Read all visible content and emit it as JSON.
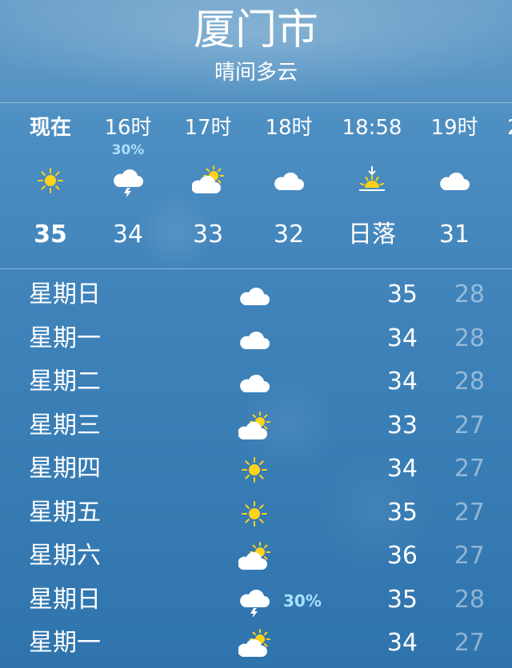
{
  "header": {
    "city": "厦门市",
    "condition": "晴间多云"
  },
  "hourly": [
    {
      "time": "现在",
      "pop": "",
      "icon": "sun-icon",
      "temp": "35"
    },
    {
      "time": "16时",
      "pop": "30%",
      "icon": "thunderstorm-icon",
      "temp": "34"
    },
    {
      "time": "17时",
      "pop": "",
      "icon": "partly-cloudy-icon",
      "temp": "33"
    },
    {
      "time": "18时",
      "pop": "",
      "icon": "cloud-icon",
      "temp": "32"
    },
    {
      "time": "18:58",
      "pop": "",
      "icon": "sunset-icon",
      "temp": "日落"
    },
    {
      "time": "19时",
      "pop": "",
      "icon": "cloud-icon",
      "temp": "31"
    },
    {
      "time": "2",
      "pop": "",
      "icon": "",
      "temp": ""
    }
  ],
  "daily": [
    {
      "day": "星期日",
      "icon": "cloud-icon",
      "pop": "",
      "high": "35",
      "low": "28"
    },
    {
      "day": "星期一",
      "icon": "cloud-icon",
      "pop": "",
      "high": "34",
      "low": "28"
    },
    {
      "day": "星期二",
      "icon": "cloud-icon",
      "pop": "",
      "high": "34",
      "low": "28"
    },
    {
      "day": "星期三",
      "icon": "partly-cloudy-icon",
      "pop": "",
      "high": "33",
      "low": "27"
    },
    {
      "day": "星期四",
      "icon": "sun-icon",
      "pop": "",
      "high": "34",
      "low": "27"
    },
    {
      "day": "星期五",
      "icon": "sun-icon",
      "pop": "",
      "high": "35",
      "low": "27"
    },
    {
      "day": "星期六",
      "icon": "partly-cloudy-icon",
      "pop": "",
      "high": "36",
      "low": "27"
    },
    {
      "day": "星期日",
      "icon": "thunderstorm-icon",
      "pop": "30%",
      "high": "35",
      "low": "28"
    },
    {
      "day": "星期一",
      "icon": "partly-cloudy-icon",
      "pop": "",
      "high": "34",
      "low": "27"
    }
  ],
  "colors": {
    "sun": "#ffd21a",
    "cloud": "#ffffff",
    "pop": "#a9e1ff"
  }
}
